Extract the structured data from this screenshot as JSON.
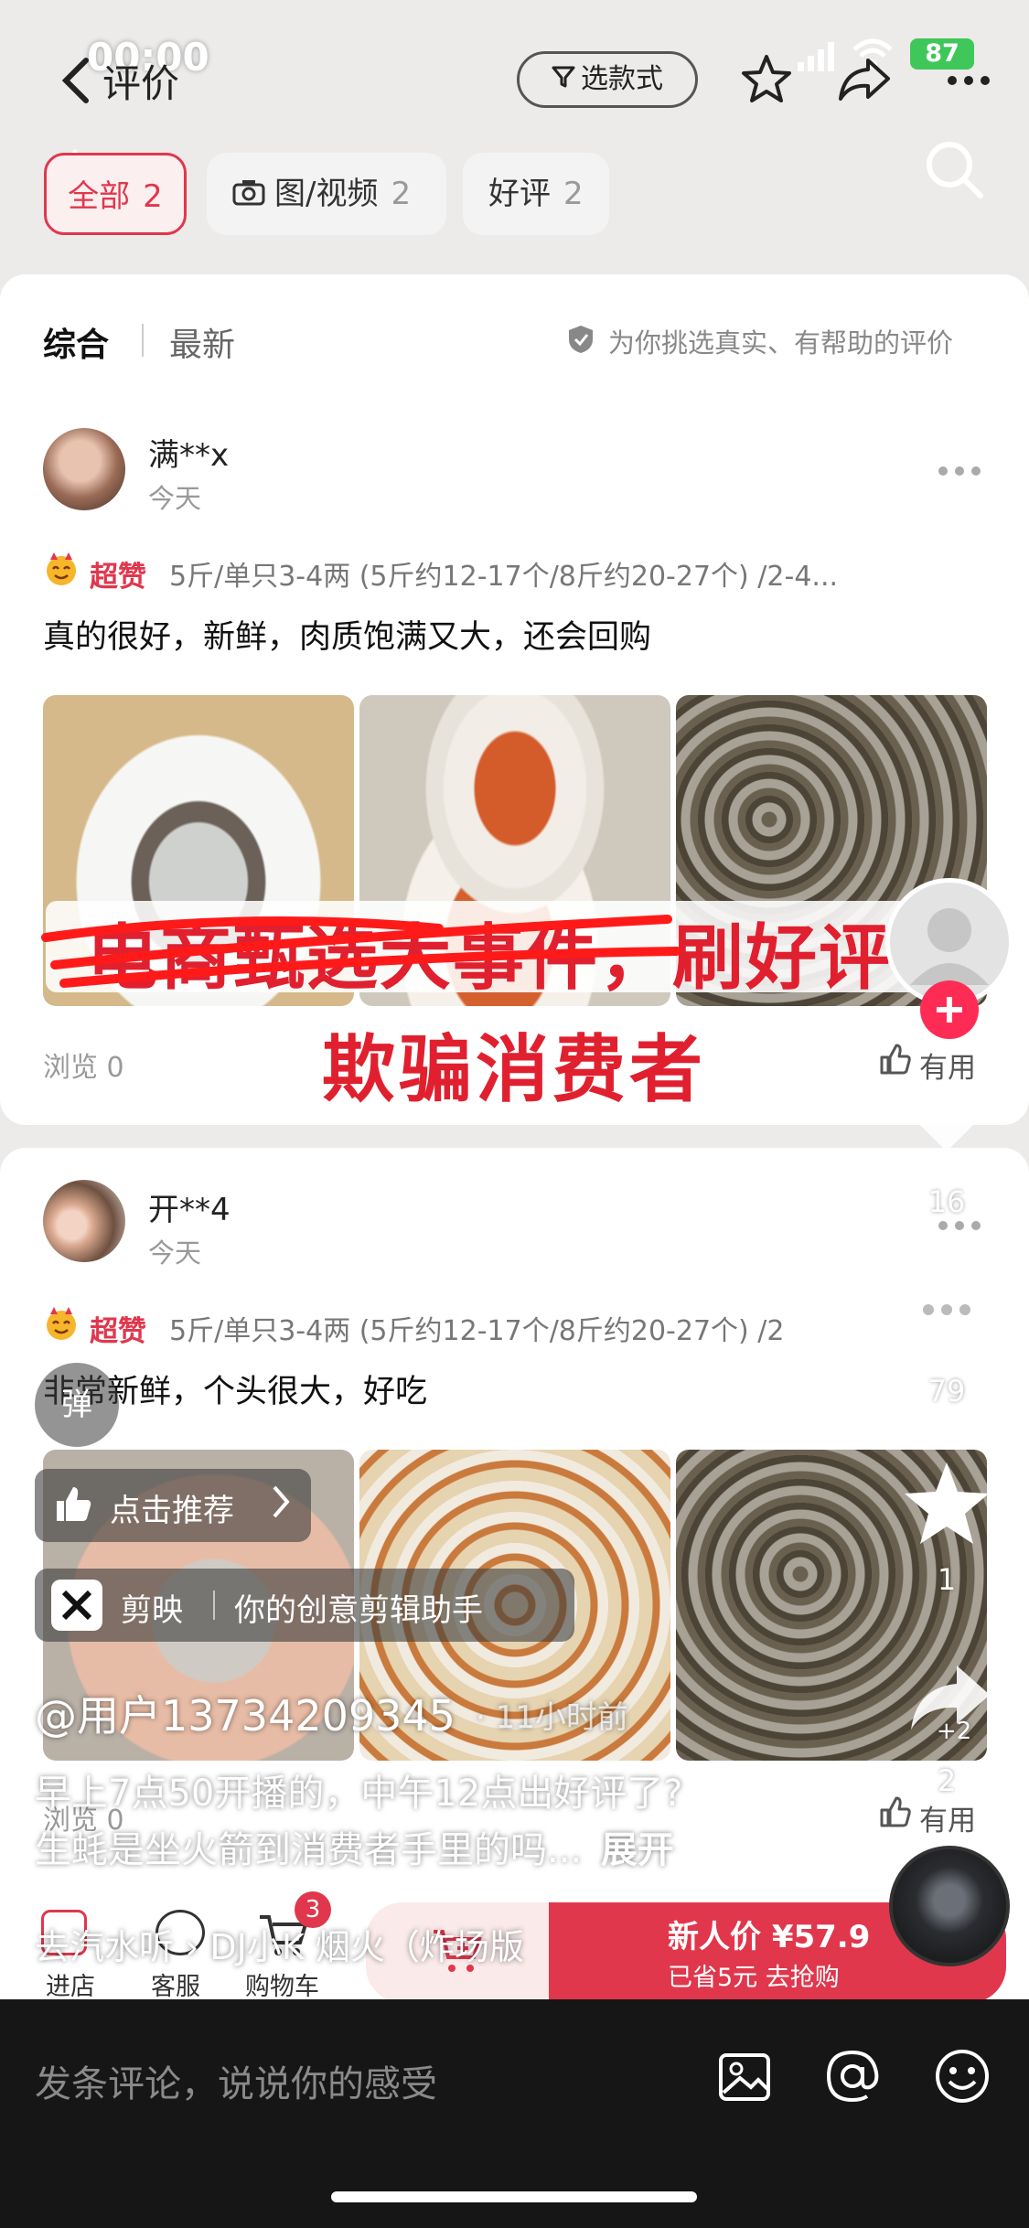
{
  "status_bar": {
    "time": "00:00",
    "battery": "87"
  },
  "header": {
    "title": "评价",
    "filter_label": "选款式"
  },
  "tabs": [
    {
      "label": "全部",
      "count": "2"
    },
    {
      "label": "图/视频",
      "count": "2"
    },
    {
      "label": "好评",
      "count": "2"
    }
  ],
  "sort": {
    "comprehensive": "综合",
    "latest": "最新",
    "note": "为你挑选真实、有帮助的评价"
  },
  "reviews": [
    {
      "user": "满**x",
      "time": "今天",
      "badge": "超赞",
      "spec": "5斤/单只3-4两 (5斤约12-17个/8斤约20-27个) /2-4...",
      "text": "真的很好，新鲜，肉质饱满又大，还会回购",
      "views": "浏览 0",
      "helpful": "有用"
    },
    {
      "user": "开**4",
      "time": "今天",
      "badge": "超赞",
      "spec": "5斤/单只3-4两 (5斤约12-17个/8斤约20-27个) /2",
      "text": "非常新鲜，个头很大，好吃",
      "views": "浏览 0",
      "helpful": "有用"
    }
  ],
  "overlay": {
    "headline_strike": "电商甄选大事件，刷好评",
    "headline_main": "欺骗消费者",
    "danmu": "弹",
    "recommend": "点击推荐",
    "capcut_name": "剪映",
    "capcut_slogan": "你的创意剪辑助手",
    "author": "@用户13734209345",
    "post_time": "· 11小时前",
    "caption_line1": "早上7点50开播的，中午12点出好评了?",
    "caption_line2": "生蚝是坐火箭到消费者手里的吗...",
    "expand": "展开",
    "music": "去汽水听 › DJ小K   烟火（炸场版",
    "likes": "16",
    "comments": "79",
    "favorites": "1",
    "shares": "2",
    "share_plus": "+2"
  },
  "bottom_shop": {
    "store": "进店",
    "service": "客服",
    "cart": "购物车",
    "cart_badge": "3",
    "price": "新人价 ¥57.9",
    "saved": "已省5元 去抢购"
  },
  "comment_bar": {
    "placeholder": "发条评论，说说你的感受"
  }
}
